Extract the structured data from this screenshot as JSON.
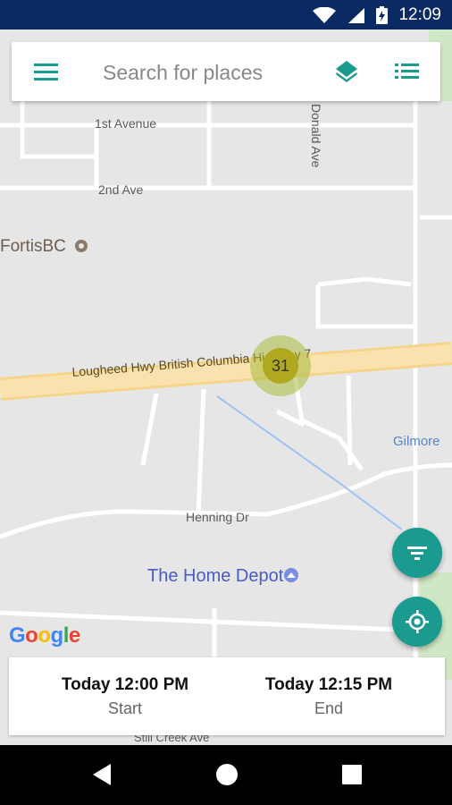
{
  "status_bar": {
    "time": "12:09"
  },
  "search": {
    "placeholder": "Search for places"
  },
  "map": {
    "labels": {
      "first_avenue": "1st Avenue",
      "second_ave": "2nd Ave",
      "donald_ave": "Donald Ave",
      "fortis": "FortisBC",
      "highway": "Lougheed Hwy  British Columbia Highway 7",
      "gilmore": "Gilmore",
      "henning": "Henning Dr",
      "home_depot": "The Home Depot",
      "still_creek": "Still Creek Ave"
    },
    "cluster_count": "31",
    "attribution": [
      "G",
      "o",
      "o",
      "g",
      "l",
      "e"
    ],
    "logo_colors": [
      "#4285F4",
      "#EA4335",
      "#FBBC05",
      "#4285F4",
      "#34A853",
      "#EA4335"
    ]
  },
  "time_range": {
    "start": {
      "value": "Today 12:00 PM",
      "label": "Start"
    },
    "end": {
      "value": "Today 12:15 PM",
      "label": "End"
    }
  },
  "colors": {
    "accent": "#1b9a8f",
    "status_bar": "#0a2a63",
    "highway": "#f7dca0"
  },
  "icons": {
    "menu": "menu-icon",
    "layers": "layers-icon",
    "list": "list-icon",
    "filter": "filter-icon",
    "locate": "my-location-icon",
    "back": "back-icon",
    "home": "home-icon",
    "recents": "recents-icon"
  }
}
